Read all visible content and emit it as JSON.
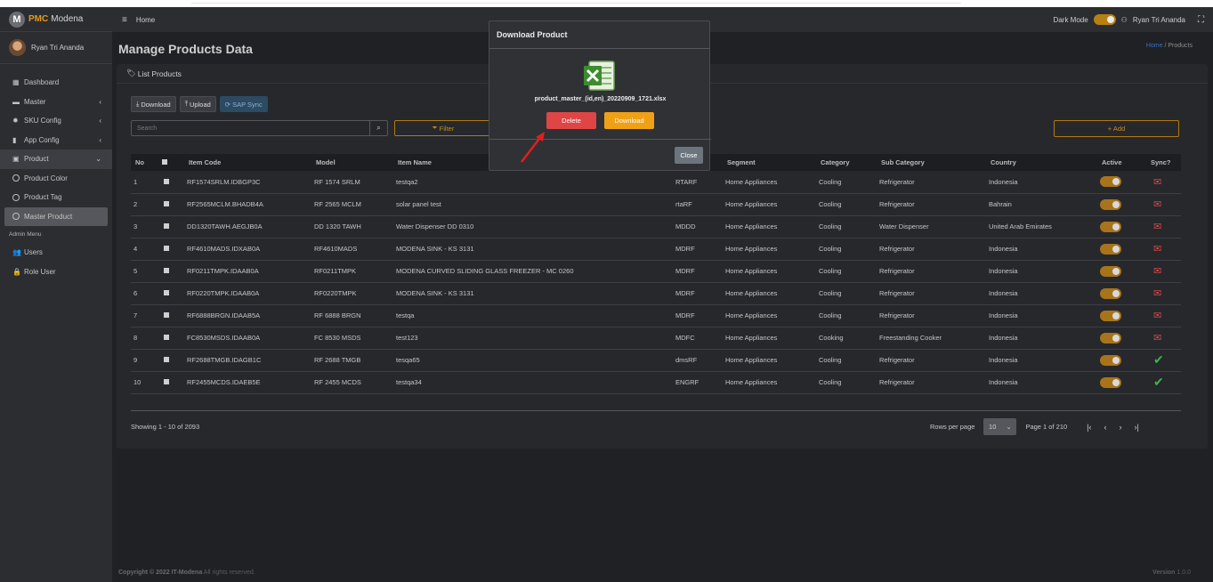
{
  "brand": {
    "b1": "PMC",
    "b2": "Modena"
  },
  "user": {
    "name": "Ryan Tri Ananda"
  },
  "nav": {
    "dashboard": "Dashboard",
    "master": "Master",
    "sku_config": "SKU Config",
    "app_config": "App Config",
    "product": "Product",
    "product_color": "Product Color",
    "product_tag": "Product Tag",
    "master_product": "Master Product",
    "admin_menu": "Admin Menu",
    "users": "Users",
    "role_user": "Role User"
  },
  "topbar": {
    "home": "Home",
    "dark_mode": "Dark Mode",
    "user": "Ryan Tri Ananda"
  },
  "page": {
    "title": "Manage Products Data",
    "crumb_home": "Home",
    "crumb_sep": "/",
    "crumb_current": "Products"
  },
  "card": {
    "title": "List Products"
  },
  "toolbar": {
    "download": "Download",
    "upload": "Upload",
    "sap_sync": "SAP Sync",
    "search_placeholder": "Search",
    "filter": "Filter",
    "add": "+ Add"
  },
  "table": {
    "headers": [
      "No",
      "",
      "Item Code",
      "Model",
      "Item Name",
      "",
      "Segment",
      "Category",
      "Sub Category",
      "Country",
      "Active",
      "Sync?"
    ],
    "rows": [
      {
        "no": "1",
        "code": "RF1574SRLM.IDBGP3C",
        "model": "RF 1574 SRLM",
        "name": "testqa2",
        "abbr": "RTARF",
        "segment": "Home Appliances",
        "category": "Cooling",
        "sub": "Refrigerator",
        "country": "Indonesia",
        "sync": "mail"
      },
      {
        "no": "2",
        "code": "RF2565MCLM.BHADB4A",
        "model": "RF 2565 MCLM",
        "name": "solar panel test",
        "abbr": "rtaRF",
        "segment": "Home Appliances",
        "category": "Cooling",
        "sub": "Refrigerator",
        "country": "Bahrain",
        "sync": "mail"
      },
      {
        "no": "3",
        "code": "DD1320TAWH.AEGJB0A",
        "model": "DD 1320 TAWH",
        "name": "Water Dispenser DD 0310",
        "abbr": "MDDD",
        "segment": "Home Appliances",
        "category": "Cooling",
        "sub": "Water Dispenser",
        "country": "United Arab Emirates",
        "sync": "mail"
      },
      {
        "no": "4",
        "code": "RF4610MADS.IDXAB0A",
        "model": "RF4610MADS",
        "name": "MODENA SINK - KS 3131",
        "abbr": "MDRF",
        "segment": "Home Appliances",
        "category": "Cooling",
        "sub": "Refrigerator",
        "country": "Indonesia",
        "sync": "mail"
      },
      {
        "no": "5",
        "code": "RF0211TMPK.IDAAB0A",
        "model": "RF0211TMPK",
        "name": "MODENA CURVED SLIDING GLASS FREEZER - MC 0260",
        "abbr": "MDRF",
        "segment": "Home Appliances",
        "category": "Cooling",
        "sub": "Refrigerator",
        "country": "Indonesia",
        "sync": "mail"
      },
      {
        "no": "6",
        "code": "RF0220TMPK.IDAAB0A",
        "model": "RF0220TMPK",
        "name": "MODENA SINK - KS 3131",
        "abbr": "MDRF",
        "segment": "Home Appliances",
        "category": "Cooling",
        "sub": "Refrigerator",
        "country": "Indonesia",
        "sync": "mail"
      },
      {
        "no": "7",
        "code": "RF6888BRGN.IDAAB5A",
        "model": "RF 6888 BRGN",
        "name": "testqa",
        "abbr": "MDRF",
        "segment": "Home Appliances",
        "category": "Cooling",
        "sub": "Refrigerator",
        "country": "Indonesia",
        "sync": "mail"
      },
      {
        "no": "8",
        "code": "FC8530MSDS.IDAAB0A",
        "model": "FC 8530 MSDS",
        "name": "test123",
        "abbr": "MDFC",
        "segment": "Home Appliances",
        "category": "Cooking",
        "sub": "Freestanding Cooker",
        "country": "Indonesia",
        "sync": "mail"
      },
      {
        "no": "9",
        "code": "RF2688TMGB.IDAGB1C",
        "model": "RF 2688 TMGB",
        "name": "tesqa65",
        "abbr": "dmsRF",
        "segment": "Home Appliances",
        "category": "Cooling",
        "sub": "Refrigerator",
        "country": "Indonesia",
        "sync": "check"
      },
      {
        "no": "10",
        "code": "RF2455MCDS.IDAEB5E",
        "model": "RF 2455 MCDS",
        "name": "testqa34",
        "abbr": "ENGRF",
        "segment": "Home Appliances",
        "category": "Cooling",
        "sub": "Refrigerator",
        "country": "Indonesia",
        "sync": "check"
      }
    ]
  },
  "pagination": {
    "showing": "Showing 1 - 10 of 2093",
    "rows_per_page": "Rows per page",
    "rows_value": "10",
    "page": "Page 1 of 210"
  },
  "footer": {
    "copyright_bold": "Copyright © 2022 IT-Modena",
    "copyright_rest": " All rights reserved.",
    "version_label": "Version",
    "version": "1.0.0"
  },
  "modal": {
    "title": "Download Product",
    "filename": "product_master_(id,en)_20220909_1721.xlsx",
    "delete": "Delete",
    "download": "Download",
    "close": "Close"
  },
  "colors": {
    "accent": "#e49a1c",
    "danger": "#e04545",
    "warning": "#f0a015",
    "success": "#44b04a"
  }
}
